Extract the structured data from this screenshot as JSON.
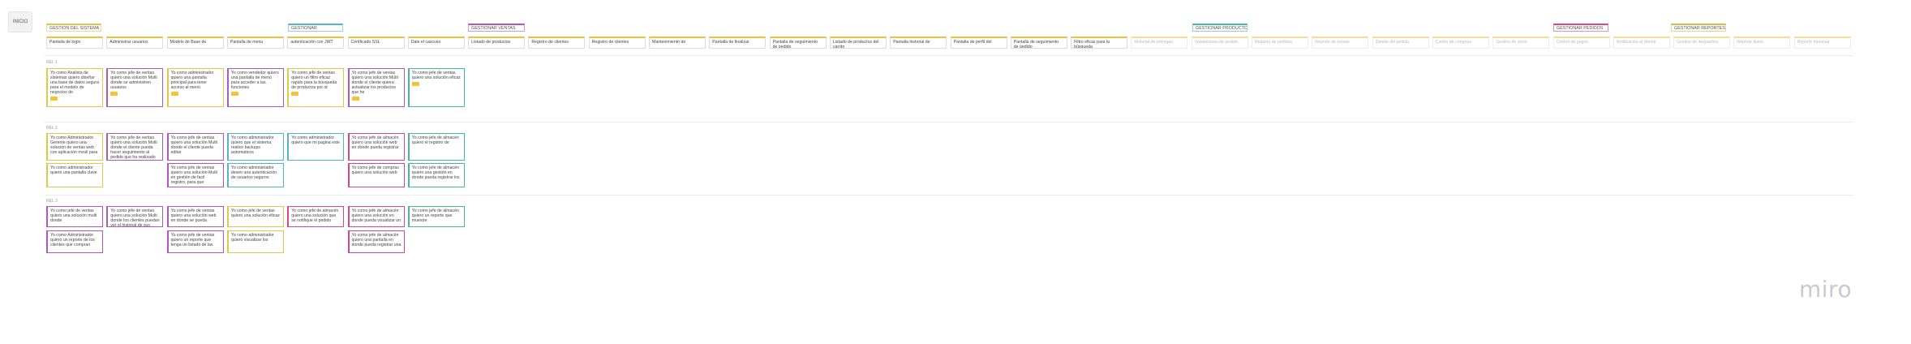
{
  "board_button": "INICIO",
  "brand": "miro",
  "epics": [
    {
      "label": "GESTION DEL SISTEMA",
      "color": "#e0c94a"
    },
    {
      "label": "GESTIONAR",
      "color": "#56b3cf"
    },
    {
      "label": "GESTIONAR VENTAS",
      "color": "#b05ab8"
    },
    {
      "label": "GESTIONAR PRODUCTOS",
      "color": "#47b99b"
    },
    {
      "label": "GESTIONAR PEDIDOS",
      "color": "#d24a8c"
    },
    {
      "label": "GESTIONAR REPORTES",
      "color": "#d9b84a"
    }
  ],
  "features": [
    "Pantalla de login",
    "Administrar usuarios",
    "Modelo de Base de",
    "Pantalla de menu",
    "autenticación con JWT",
    "Certificado SSL",
    "Dale el cascuso",
    "Listado de productos",
    "Registro de clientes",
    "Registro de clientes",
    "Mantenimiento de",
    "Pantalla de finalizar",
    "Pantalla de seguimiento de pedido",
    "Listado de productos del carrito",
    "Pantalla historial de",
    "Pantalla de perfil del",
    "Pantalla de seguimiento de pedido",
    "Filtro eficaz para la búsqueda",
    "Historial de entregas",
    "Validaciones de pedido",
    "Registro de pedidos",
    "Reporte de ventas",
    "Detalle del pedido",
    "Carrito de compras",
    "Gestion de stock",
    "Control de pagos",
    "Notificación al cliente",
    "Gestion de despachos",
    "Reporte diario",
    "Reporte mensual"
  ],
  "releases": [
    "REL 1",
    "REL 2",
    "REL 3"
  ],
  "row1": [
    {
      "text": "Yo como Analista de sistemas quiero diseñar una base de datos segura para el modelo de negocios de",
      "color": "#e0c94a",
      "sticker": true
    },
    {
      "text": "Yo como jefe de ventas quiero una solución Multi donde se administren usuarios",
      "color": "#b05ab8",
      "sticker": true
    },
    {
      "text": "Yo como administrador quiero una pantalla principal para tener acceso al menú",
      "color": "#e0c94a",
      "sticker": true
    },
    {
      "text": "Yo como vendedor quiero una pantalla de menú para acceder a las funciones",
      "color": "#b05ab8",
      "sticker": true
    },
    {
      "text": "Yo como jefe de ventas quiero un filtro eficaz rapido para la búsqueda de productos por id",
      "color": "#e0c94a",
      "sticker": true
    },
    {
      "text": "Yo como jefe de ventas quiero una solución Multi donde el cliente quiera actualizar los productos que he",
      "color": "#b05ab8",
      "sticker": true
    },
    {
      "text": "Yo como jefe de ventas quiero una solución eficaz",
      "color": "#47b99b",
      "sticker": true
    }
  ],
  "row2a": [
    {
      "text": "Yo como Administrador. Gerente quiero una solución de ventas web con aplicación movil para",
      "color": "#e0c94a"
    },
    {
      "text": "Yo como jefe de ventas quiero una solución Multi donde el cliente pueda hacer seguimiento al pedido que ha realizado",
      "color": "#b05ab8"
    },
    {
      "text": "Yo como jefe de ventas quiero una solución Multi donde el cliente pueda editar",
      "color": "#b05ab8"
    },
    {
      "text": "Yo como administrador quiero que el sistema realice backups automaticos",
      "color": "#56b3cf"
    },
    {
      "text": "Yo como administrador quiero que mi pagina este",
      "color": "#56b3cf"
    },
    {
      "text": "Yo como jefe de almacén quiero una solución web en donde pueda registrar",
      "color": "#d24a8c"
    },
    {
      "text": "Yo como jefe de almacén quiero el registro de",
      "color": "#47b99b"
    }
  ],
  "row2b": [
    {
      "text": "Yo como administrador quiero una pantalla clave",
      "color": "#e0c94a"
    },
    {
      "text": "Yo como jefe de ventas quiero una solucion Multi en gestión de facil registro, para que",
      "color": "#b05ab8"
    },
    {
      "text": "Yo como administrador deseo una autenticación de usuarios seguros",
      "color": "#56b3cf"
    },
    {
      "text": "Yo como jefe de compras quiero una solución web",
      "color": "#d24a8c"
    },
    {
      "text": "Yo como jefe de almacén quiero una gestión en donde pueda registrar los",
      "color": "#47b99b"
    }
  ],
  "row3a": [
    {
      "text": "Yo como jefe de ventas quiero una solución multi donde",
      "color": "#b05ab8"
    },
    {
      "text": "Yo como jefe de ventas quiero una solución Multi donde los clientes puedan ver el historial de sus",
      "color": "#b05ab8"
    },
    {
      "text": "Yo como jefe de ventas quiero una solución web en donde se pueda",
      "color": "#b05ab8"
    },
    {
      "text": "Yo como jefe de ventas quiero una solución eficaz",
      "color": "#e0c94a"
    },
    {
      "text": "Yo como jefe de almacén quiero una solución que se notifique el pedido",
      "color": "#d24a8c"
    },
    {
      "text": "Yo como jefe de almacén quiero una solución en donde pueda visualizar un",
      "color": "#d24a8c"
    },
    {
      "text": "Yo como jefe de almacén quiero un reporte que muestre",
      "color": "#47b99b"
    }
  ],
  "row3b": [
    {
      "text": "Yo como Administrador quiero un reporte de los clientes que compran",
      "color": "#b05ab8"
    },
    {
      "text": "Yo como jefe de ventas quiero un reporte que tenga un listado de las",
      "color": "#b05ab8"
    },
    {
      "text": "Yo como administrador quiero visualizar los",
      "color": "#e0c94a"
    },
    {
      "text": "Yo como jefe de almacén quiero una pantalla en donde pueda registrar una",
      "color": "#d24a8c"
    }
  ]
}
